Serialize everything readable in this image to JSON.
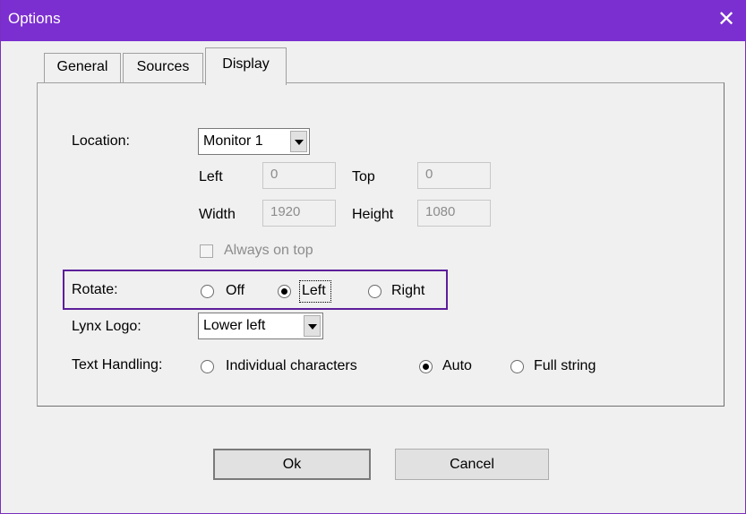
{
  "window": {
    "title": "Options",
    "close_glyph": "✕"
  },
  "tabs": [
    {
      "label": "General",
      "active": false
    },
    {
      "label": "Sources",
      "active": false
    },
    {
      "label": "Display",
      "active": true
    }
  ],
  "display": {
    "location": {
      "label": "Location:",
      "value": "Monitor 1"
    },
    "left": {
      "label": "Left",
      "value": "0"
    },
    "top": {
      "label": "Top",
      "value": "0"
    },
    "width": {
      "label": "Width",
      "value": "1920"
    },
    "height": {
      "label": "Height",
      "value": "1080"
    },
    "always_on_top": {
      "label": "Always on top",
      "checked": false,
      "enabled": false
    },
    "rotate": {
      "label": "Rotate:",
      "options": [
        {
          "label": "Off",
          "checked": false
        },
        {
          "label": "Left",
          "checked": true
        },
        {
          "label": "Right",
          "checked": false
        }
      ]
    },
    "lynx_logo": {
      "label": "Lynx Logo:",
      "value": "Lower left"
    },
    "text_handling": {
      "label": "Text Handling:",
      "options": [
        {
          "label": "Individual characters",
          "checked": false
        },
        {
          "label": "Auto",
          "checked": true
        },
        {
          "label": "Full string",
          "checked": false
        }
      ]
    }
  },
  "buttons": {
    "ok": "Ok",
    "cancel": "Cancel"
  },
  "colors": {
    "titlebar": "#7b2fd0",
    "highlight_border": "#5d1f9a"
  }
}
